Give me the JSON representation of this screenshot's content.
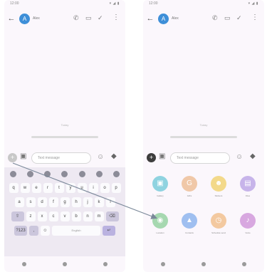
{
  "status_bar": {
    "time": "12:00",
    "icons": "▾ ◢ ▮"
  },
  "conversation": {
    "contact_name": "Alex",
    "avatar_initial": "A",
    "time_label": "Today"
  },
  "compose": {
    "placeholder": "Text message"
  },
  "keyboard": {
    "row1": [
      "q",
      "w",
      "e",
      "r",
      "t",
      "y",
      "u",
      "i",
      "o",
      "p"
    ],
    "row2": [
      "a",
      "s",
      "d",
      "f",
      "g",
      "h",
      "j",
      "k",
      "l"
    ],
    "row3": [
      "z",
      "x",
      "c",
      "v",
      "b",
      "n",
      "m"
    ],
    "shift_label": "⇧",
    "backspace_label": "⌫",
    "symbols_label": "?123",
    "comma_label": ",",
    "emoji_label": "☺",
    "space_label": "English",
    "enter_label": "↵"
  },
  "attachment_panel": {
    "items": [
      {
        "label": "Gallery",
        "icon": "image-icon",
        "glyph": "▣",
        "color": "#8fd3e0"
      },
      {
        "label": "GIFs",
        "icon": "gif-icon",
        "glyph": "G",
        "color": "#f0c8a8"
      },
      {
        "label": "Stickers",
        "icon": "sticker-icon",
        "glyph": "☻",
        "color": "#f3d98a"
      },
      {
        "label": "Files",
        "icon": "file-icon",
        "glyph": "▤",
        "color": "#c7b4ea"
      },
      {
        "label": "Location",
        "icon": "location-icon",
        "glyph": "◉",
        "color": "#a6d8b0"
      },
      {
        "label": "Contacts",
        "icon": "contact-icon",
        "glyph": "▲",
        "color": "#9fbff0"
      },
      {
        "label": "Schedule send",
        "icon": "schedule-icon",
        "glyph": "◷",
        "color": "#f3c9a0"
      },
      {
        "label": "Voice",
        "icon": "voice-icon",
        "glyph": "♪",
        "color": "#d8a8e0"
      }
    ]
  },
  "colors": {
    "accent": "#3e8fd8",
    "keyboard_bg": "#eee9f2",
    "arrow": "#7a8899"
  }
}
